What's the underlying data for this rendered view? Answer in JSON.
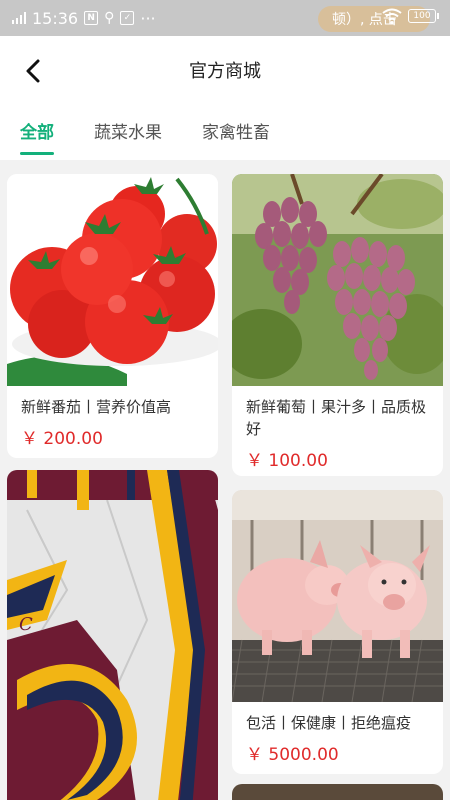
{
  "status": {
    "time": "15:36",
    "ticker": "顿）, 点击",
    "battery": "100"
  },
  "header": {
    "title": "官方商城"
  },
  "tabs": [
    {
      "label": "全部",
      "active": true
    },
    {
      "label": "蔬菜水果",
      "active": false
    },
    {
      "label": "家禽牲畜",
      "active": false
    }
  ],
  "products": [
    {
      "name": "新鲜番茄丨营养价值高",
      "price": "￥ 200.00",
      "image": "tomatoes"
    },
    {
      "name": "新鲜葡萄丨果汁多丨品质极好",
      "price": "￥ 100.00",
      "image": "grapes"
    },
    {
      "name": "",
      "price": "",
      "image": "basketball-logo-artwork"
    },
    {
      "name": "包活丨保健康丨拒绝瘟疫",
      "price": "￥ 5000.00",
      "image": "pigs"
    }
  ],
  "colors": {
    "accent": "#13b07b",
    "price": "#e02b2b"
  }
}
